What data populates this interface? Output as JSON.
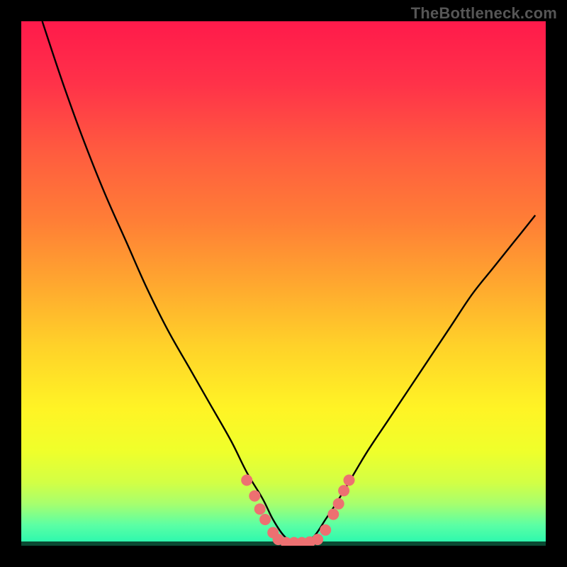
{
  "watermark": "TheBottleneck.com",
  "colors": {
    "frame": "#000000",
    "curve": "#000000",
    "marker_fill": "#ED7071",
    "marker_stroke": "#ED7071",
    "gradient": [
      {
        "offset": 0.0,
        "color": "#FF1A4B"
      },
      {
        "offset": 0.12,
        "color": "#FF3249"
      },
      {
        "offset": 0.25,
        "color": "#FF5C3F"
      },
      {
        "offset": 0.38,
        "color": "#FF7E36"
      },
      {
        "offset": 0.5,
        "color": "#FFA72F"
      },
      {
        "offset": 0.62,
        "color": "#FFD229"
      },
      {
        "offset": 0.74,
        "color": "#FFF425"
      },
      {
        "offset": 0.82,
        "color": "#EFFF2B"
      },
      {
        "offset": 0.88,
        "color": "#D2FF45"
      },
      {
        "offset": 0.92,
        "color": "#A7FF6E"
      },
      {
        "offset": 0.96,
        "color": "#5CFFA4"
      },
      {
        "offset": 1.0,
        "color": "#23F7B0"
      }
    ]
  },
  "chart_data": {
    "type": "line",
    "title": "",
    "xlabel": "",
    "ylabel": "",
    "xlim": [
      0,
      100
    ],
    "ylim": [
      0,
      100
    ],
    "series": [
      {
        "name": "bottleneck-curve",
        "x": [
          4,
          8,
          12,
          16,
          20,
          24,
          28,
          32,
          36,
          40,
          43,
          46,
          48,
          50,
          52,
          54,
          56,
          58,
          60,
          63,
          66,
          70,
          74,
          78,
          82,
          86,
          90,
          94,
          98
        ],
        "y": [
          100,
          88,
          77,
          67,
          58,
          49,
          41,
          34,
          27,
          20,
          14,
          9,
          5,
          2,
          0.5,
          0.5,
          2,
          5,
          8,
          13,
          18,
          24,
          30,
          36,
          42,
          48,
          53,
          58,
          63
        ]
      }
    ],
    "markers": {
      "name": "highlight-dots",
      "points": [
        {
          "x": 43.0,
          "y": 12.5
        },
        {
          "x": 44.5,
          "y": 9.5
        },
        {
          "x": 45.5,
          "y": 7.0
        },
        {
          "x": 46.5,
          "y": 5.0
        },
        {
          "x": 48.0,
          "y": 2.5
        },
        {
          "x": 49.0,
          "y": 1.2
        },
        {
          "x": 50.5,
          "y": 0.6
        },
        {
          "x": 52.0,
          "y": 0.6
        },
        {
          "x": 53.5,
          "y": 0.6
        },
        {
          "x": 55.0,
          "y": 0.7
        },
        {
          "x": 56.5,
          "y": 1.2
        },
        {
          "x": 58.0,
          "y": 3.0
        },
        {
          "x": 59.5,
          "y": 6.0
        },
        {
          "x": 60.5,
          "y": 8.0
        },
        {
          "x": 61.5,
          "y": 10.5
        },
        {
          "x": 62.5,
          "y": 12.5
        }
      ]
    }
  }
}
